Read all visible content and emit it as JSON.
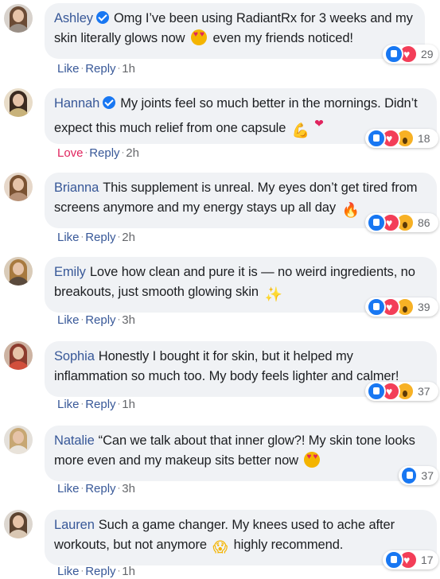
{
  "colors": {
    "name": "#385898",
    "bubble": "#f0f2f5",
    "text": "#1c1e21",
    "meta": "#65676b",
    "love_action": "#e0245e"
  },
  "comments": [
    {
      "name": "Ashley",
      "verified": true,
      "text_before": "Omg I’ve been using RadiantRx for 3 weeks and my skin literally glows now",
      "emoji": "smiling-face-heart-eyes",
      "text_after": "even my friends noticed!",
      "action": "Like",
      "reply": "Reply",
      "time": "1h",
      "reactions": [
        "like",
        "love"
      ],
      "reaction_count": "29"
    },
    {
      "name": "Hannah",
      "verified": true,
      "text_before": "My joints feel so much better in the mornings. Didn’t expect this much relief from one capsule",
      "emoji": "flexed-biceps",
      "text_after": "",
      "action": "Love",
      "reply": "Reply",
      "time": "2h",
      "reactions": [
        "like",
        "love",
        "wow"
      ],
      "reaction_count": "18"
    },
    {
      "name": "Brianna",
      "verified": false,
      "text_before": "This supplement is unreal. My eyes don’t get tired from screens anymore and my energy stays up all day",
      "emoji": "fire",
      "text_after": "",
      "action": "Like",
      "reply": "Reply",
      "time": "2h",
      "reactions": [
        "like",
        "love",
        "wow"
      ],
      "reaction_count": "86"
    },
    {
      "name": "Emily",
      "verified": false,
      "text_before": "Love how clean and pure it is — no weird ingredients, no breakouts, just smooth glowing skin",
      "emoji": "sparkles",
      "text_after": "",
      "action": "Like",
      "reply": "Reply",
      "time": "3h",
      "reactions": [
        "like",
        "love",
        "wow"
      ],
      "reaction_count": "39"
    },
    {
      "name": "Sophia",
      "verified": false,
      "text_before": "Honestly I bought it for skin, but it helped my inflammation so much too. My body feels lighter and calmer!",
      "emoji": "",
      "text_after": "",
      "action": "Like",
      "reply": "Reply",
      "time": "1h",
      "reactions": [
        "like",
        "love",
        "wow"
      ],
      "reaction_count": "37"
    },
    {
      "name": "Natalie",
      "verified": false,
      "text_before": "“Can we talk about that inner glow?! My skin tone looks more even and my makeup sits better now",
      "emoji": "smiling-face-heart-eyes",
      "text_after": "",
      "action": "Like",
      "reply": "Reply",
      "time": "3h",
      "reactions": [
        "like"
      ],
      "reaction_count": "37"
    },
    {
      "name": "Lauren",
      "verified": false,
      "text_before": "Such a game changer. My knees used to ache after workouts, but not anymore",
      "emoji": "face-screaming-hands",
      "text_after": "highly recommend.",
      "action": "Like",
      "reply": "Reply",
      "time": "1h",
      "reactions": [
        "like",
        "love"
      ],
      "reaction_count": "17"
    }
  ]
}
